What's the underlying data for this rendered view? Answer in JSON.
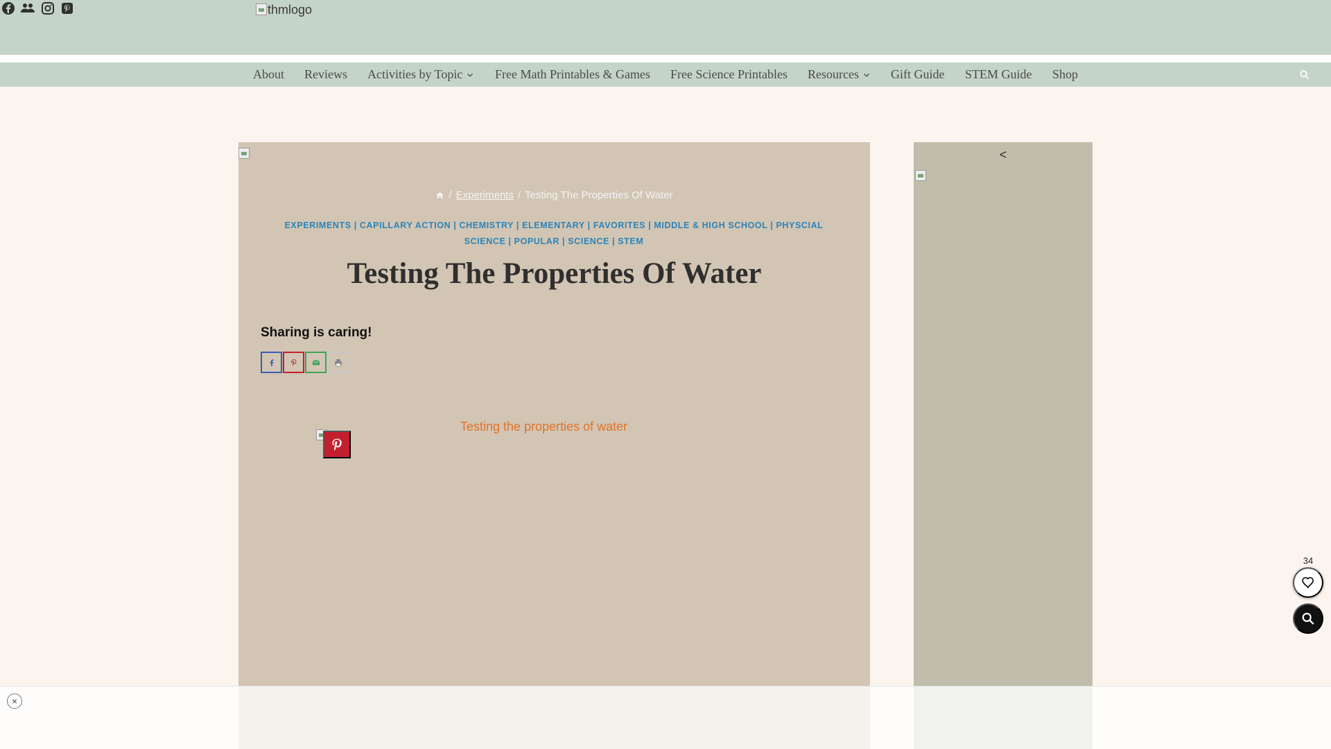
{
  "header": {
    "logo_alt": "thmlogo",
    "social_icons": [
      "facebook-icon",
      "facebook-group-icon",
      "instagram-icon",
      "pinterest-icon"
    ]
  },
  "nav": {
    "items": [
      {
        "label": "About",
        "has_dropdown": false
      },
      {
        "label": "Reviews",
        "has_dropdown": false
      },
      {
        "label": "Activities by Topic",
        "has_dropdown": true
      },
      {
        "label": "Free Math Printables & Games",
        "has_dropdown": false
      },
      {
        "label": "Free Science Printables",
        "has_dropdown": false
      },
      {
        "label": "Resources",
        "has_dropdown": true
      },
      {
        "label": "Gift Guide",
        "has_dropdown": false
      },
      {
        "label": "STEM Guide",
        "has_dropdown": false
      },
      {
        "label": "Shop",
        "has_dropdown": false
      }
    ]
  },
  "article": {
    "breadcrumb": {
      "separator": "/",
      "link": "Experiments",
      "current": "Testing The Properties Of Water"
    },
    "categories": "EXPERIMENTS | CAPILLARY ACTION | CHEMISTRY | ELEMENTARY | FAVORITES | MIDDLE & HIGH SCHOOL | PHYSCIAL SCIENCE | POPULAR | SCIENCE | STEM",
    "title": "Testing The Properties Of Water",
    "share_heading": "Sharing is caring!",
    "hero_alt": "Testing the properties of water"
  },
  "sidebar": {
    "arrow": "<"
  },
  "floating": {
    "favorite_count": "34"
  },
  "ad_bar": {
    "close_label": "×"
  },
  "colors": {
    "header_bg": "#c5d4c8",
    "page_bg": "#fcf5ef",
    "card_bg": "#d2c5b3",
    "sidebar_bg": "#c1bdab",
    "category_blue": "#2b84b8",
    "facebook_blue": "#3b5bb5",
    "pinterest_red": "#c41f2e",
    "email_green": "#3aa55a"
  }
}
